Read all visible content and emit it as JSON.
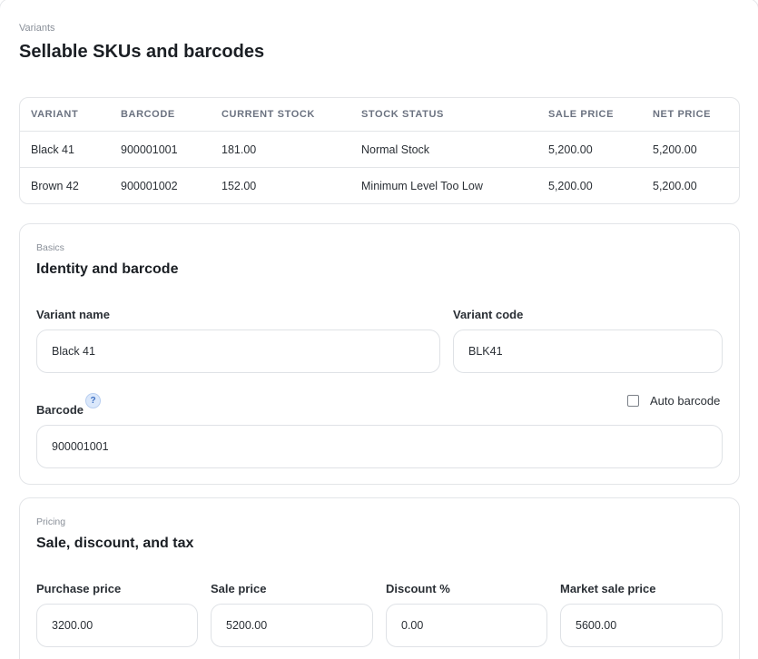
{
  "header": {
    "eyebrow": "Variants",
    "title": "Sellable SKUs and barcodes"
  },
  "table": {
    "columns": [
      "VARIANT",
      "BARCODE",
      "CURRENT STOCK",
      "STOCK STATUS",
      "SALE PRICE",
      "NET PRICE"
    ],
    "rows": [
      [
        "Black 41",
        "900001001",
        "181.00",
        "Normal Stock",
        "5,200.00",
        "5,200.00"
      ],
      [
        "Brown 42",
        "900001002",
        "152.00",
        "Minimum Level Too Low",
        "5,200.00",
        "5,200.00"
      ]
    ]
  },
  "basics": {
    "eyebrow": "Basics",
    "title": "Identity and barcode",
    "variant_name_label": "Variant name",
    "variant_name_value": "Black 41",
    "variant_code_label": "Variant code",
    "variant_code_value": "BLK41",
    "barcode_label": "Barcode",
    "barcode_help": "?",
    "auto_barcode_label": "Auto barcode",
    "auto_barcode_checked": false,
    "barcode_value": "900001001"
  },
  "pricing": {
    "eyebrow": "Pricing",
    "title": "Sale, discount, and tax",
    "purchase_price_label": "Purchase price",
    "purchase_price_value": "3200.00",
    "sale_price_label": "Sale price",
    "sale_price_value": "5200.00",
    "discount_label": "Discount %",
    "discount_value": "0.00",
    "market_sale_price_label": "Market sale price",
    "market_sale_price_value": "5600.00"
  }
}
